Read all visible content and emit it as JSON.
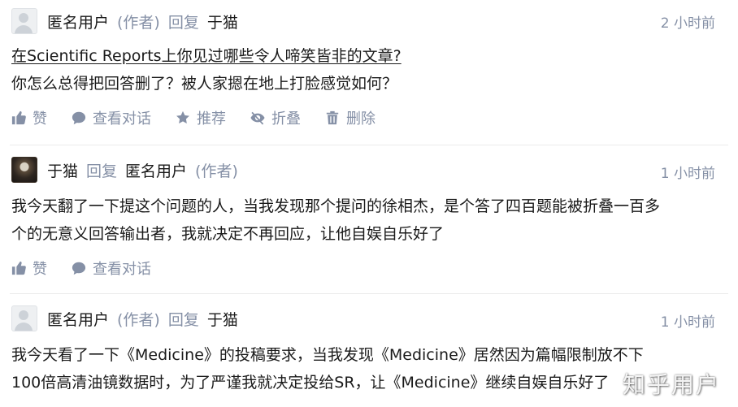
{
  "comments": [
    {
      "author": "匿名用户",
      "author_tag": "(作者)",
      "reply_word": "回复",
      "reply_to": "于猫",
      "time": "2 小时前",
      "question_link": "在Scientific Reports上你见过哪些令人啼笑皆非的文章?",
      "text": "你怎么总得把回答删了？被人家摁在地上打脸感觉如何？",
      "actions": {
        "like": "赞",
        "view_dialog": "查看对话",
        "recommend": "推荐",
        "collapse": "折叠",
        "delete": "删除"
      }
    },
    {
      "author": "于猫",
      "reply_word": "回复",
      "reply_to": "匿名用户",
      "reply_to_tag": "(作者)",
      "time": "1 小时前",
      "text_lines": [
        "我今天翻了一下提这个问题的人，当我发现那个提问的徐相杰，是个答了四百题能被折叠一百多",
        "个的无意义回答输出者，我就决定不再回应，让他自娱自乐好了"
      ],
      "actions": {
        "like": "赞",
        "view_dialog": "查看对话"
      }
    },
    {
      "author": "匿名用户",
      "author_tag": "(作者)",
      "reply_word": "回复",
      "reply_to": "于猫",
      "time": "1 小时前",
      "text_lines": [
        "我今天看了一下《Medicine》的投稿要求，当我发现《Medicine》居然因为篇幅限制放不下",
        "100倍高清油镜数据时，为了严谨我就决定投给SR，让《Medicine》继续自娱自乐好了"
      ]
    }
  ],
  "watermark": "知乎用户"
}
